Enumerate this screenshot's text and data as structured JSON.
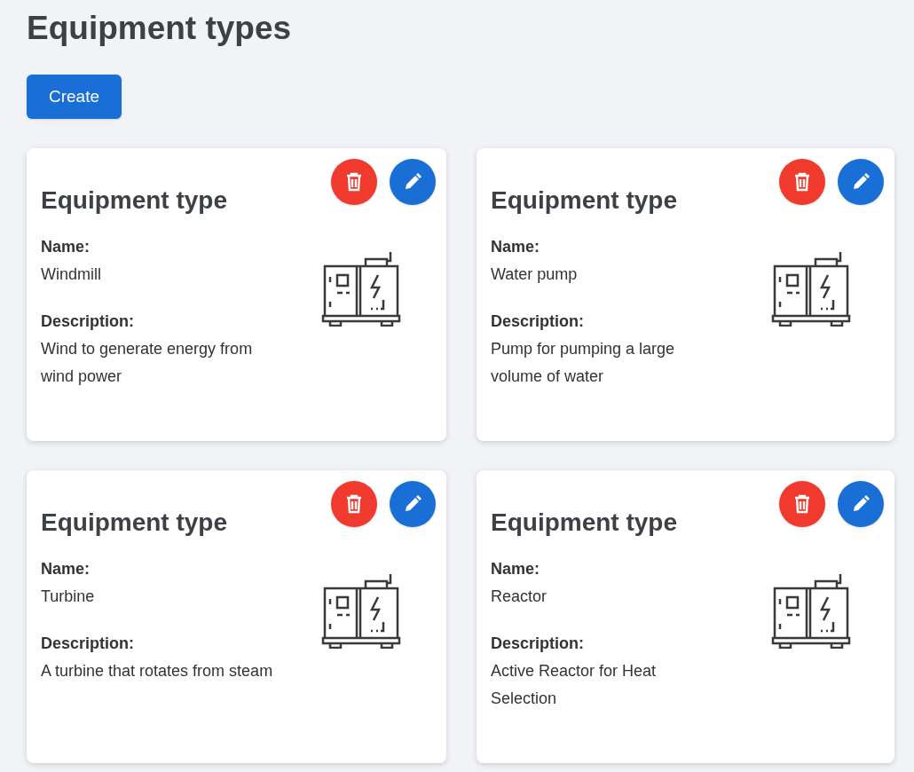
{
  "page": {
    "title": "Equipment types"
  },
  "create_button": {
    "label": "Create"
  },
  "cards": [
    {
      "title": "Equipment type",
      "name_label": "Name:",
      "name": "Windmill",
      "description_label": "Description:",
      "description": "Wind to generate energy from wind power"
    },
    {
      "title": "Equipment type",
      "name_label": "Name:",
      "name": "Water pump",
      "description_label": "Description:",
      "description": "Pump for pumping a large volume of water"
    },
    {
      "title": "Equipment type",
      "name_label": "Name:",
      "name": "Turbine",
      "description_label": "Description:",
      "description": "A turbine that rotates from steam"
    },
    {
      "title": "Equipment type",
      "name_label": "Name:",
      "name": "Reactor",
      "description_label": "Description:",
      "description": "Active Reactor for Heat Selection"
    }
  ]
}
